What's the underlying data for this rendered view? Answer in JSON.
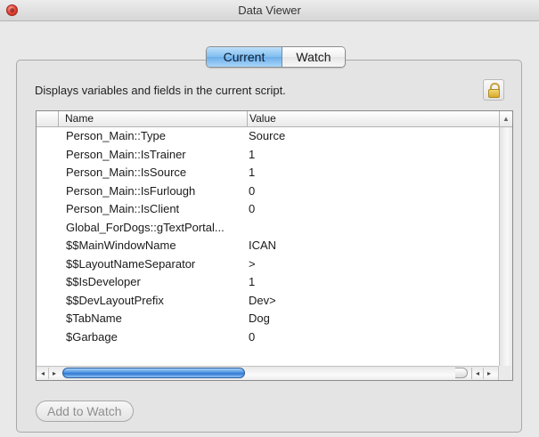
{
  "window": {
    "title": "Data Viewer"
  },
  "tabs": [
    {
      "label": "Current",
      "selected": true
    },
    {
      "label": "Watch",
      "selected": false
    }
  ],
  "description": "Displays variables and fields in the current script.",
  "table": {
    "columns": [
      "Name",
      "Value"
    ],
    "rows": [
      {
        "name": "Person_Main::Type",
        "value": "Source"
      },
      {
        "name": "Person_Main::IsTrainer",
        "value": "1"
      },
      {
        "name": "Person_Main::IsSource",
        "value": "1"
      },
      {
        "name": "Person_Main::IsFurlough",
        "value": "0"
      },
      {
        "name": "Person_Main::IsClient",
        "value": "0"
      },
      {
        "name": "Global_ForDogs::gTextPortal...",
        "value": ""
      },
      {
        "name": "$$MainWindowName",
        "value": "ICAN"
      },
      {
        "name": "$$LayoutNameSeparator",
        "value": ">"
      },
      {
        "name": "$$IsDeveloper",
        "value": "1"
      },
      {
        "name": "$$DevLayoutPrefix",
        "value": "Dev>"
      },
      {
        "name": "$TabName",
        "value": "Dog"
      },
      {
        "name": "$Garbage",
        "value": "0"
      }
    ]
  },
  "buttons": {
    "add_to_watch": "Add to Watch"
  },
  "icons": {
    "close": "close-icon",
    "lock": "lock-icon",
    "scroll_left": "◂",
    "scroll_right": "▸",
    "sort": "▲"
  },
  "colors": {
    "selected_tab": "#7fbef0",
    "scroll_thumb": "#2f78d1",
    "close_button": "#e8473a",
    "lock": "#d8a92b"
  }
}
